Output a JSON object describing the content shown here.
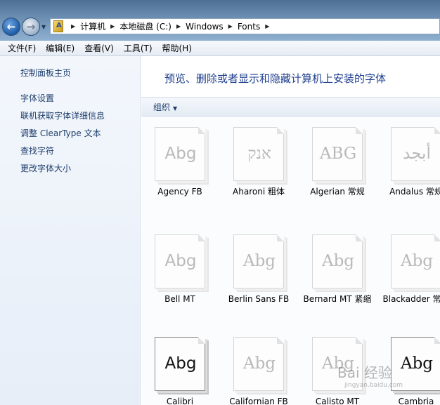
{
  "address": {
    "crumbs": [
      "计算机",
      "本地磁盘 (C:)",
      "Windows",
      "Fonts"
    ]
  },
  "menu": [
    "文件(F)",
    "编辑(E)",
    "查看(V)",
    "工具(T)",
    "帮助(H)"
  ],
  "sidebar": {
    "home": "控制面板主页",
    "links": [
      "字体设置",
      "联机获取字体详细信息",
      "调整 ClearType 文本",
      "查找字符",
      "更改字体大小"
    ]
  },
  "main": {
    "heading": "预览、删除或者显示和隐藏计算机上安装的字体",
    "organize": "组织"
  },
  "fonts": [
    {
      "name": "Agency FB",
      "sample": "Abg",
      "dark": false
    },
    {
      "name": "Aharoni 粗体",
      "sample": "אנק",
      "dark": false
    },
    {
      "name": "Algerian 常规",
      "sample": "ABG",
      "dark": false
    },
    {
      "name": "Andalus 常规",
      "sample": "أبجد",
      "dark": false
    },
    {
      "name": "Bell MT",
      "sample": "Abg",
      "dark": false
    },
    {
      "name": "Berlin Sans FB",
      "sample": "Abg",
      "dark": false
    },
    {
      "name": "Bernard MT 紧缩",
      "sample": "Abg",
      "dark": false
    },
    {
      "name": "Blackadder 常规",
      "sample": "Abg",
      "dark": false
    },
    {
      "name": "Calibri",
      "sample": "Abg",
      "dark": true
    },
    {
      "name": "Californian FB",
      "sample": "Abg",
      "dark": false
    },
    {
      "name": "Calisto MT",
      "sample": "Abg",
      "dark": false
    },
    {
      "name": "Cambria",
      "sample": "Abg",
      "dark": true
    }
  ],
  "watermark": {
    "main": "Bai 经验",
    "sub": "jingyan.baidu.com"
  },
  "colors": {
    "link": "#1e3d6b",
    "heading": "#1f3f8f"
  }
}
